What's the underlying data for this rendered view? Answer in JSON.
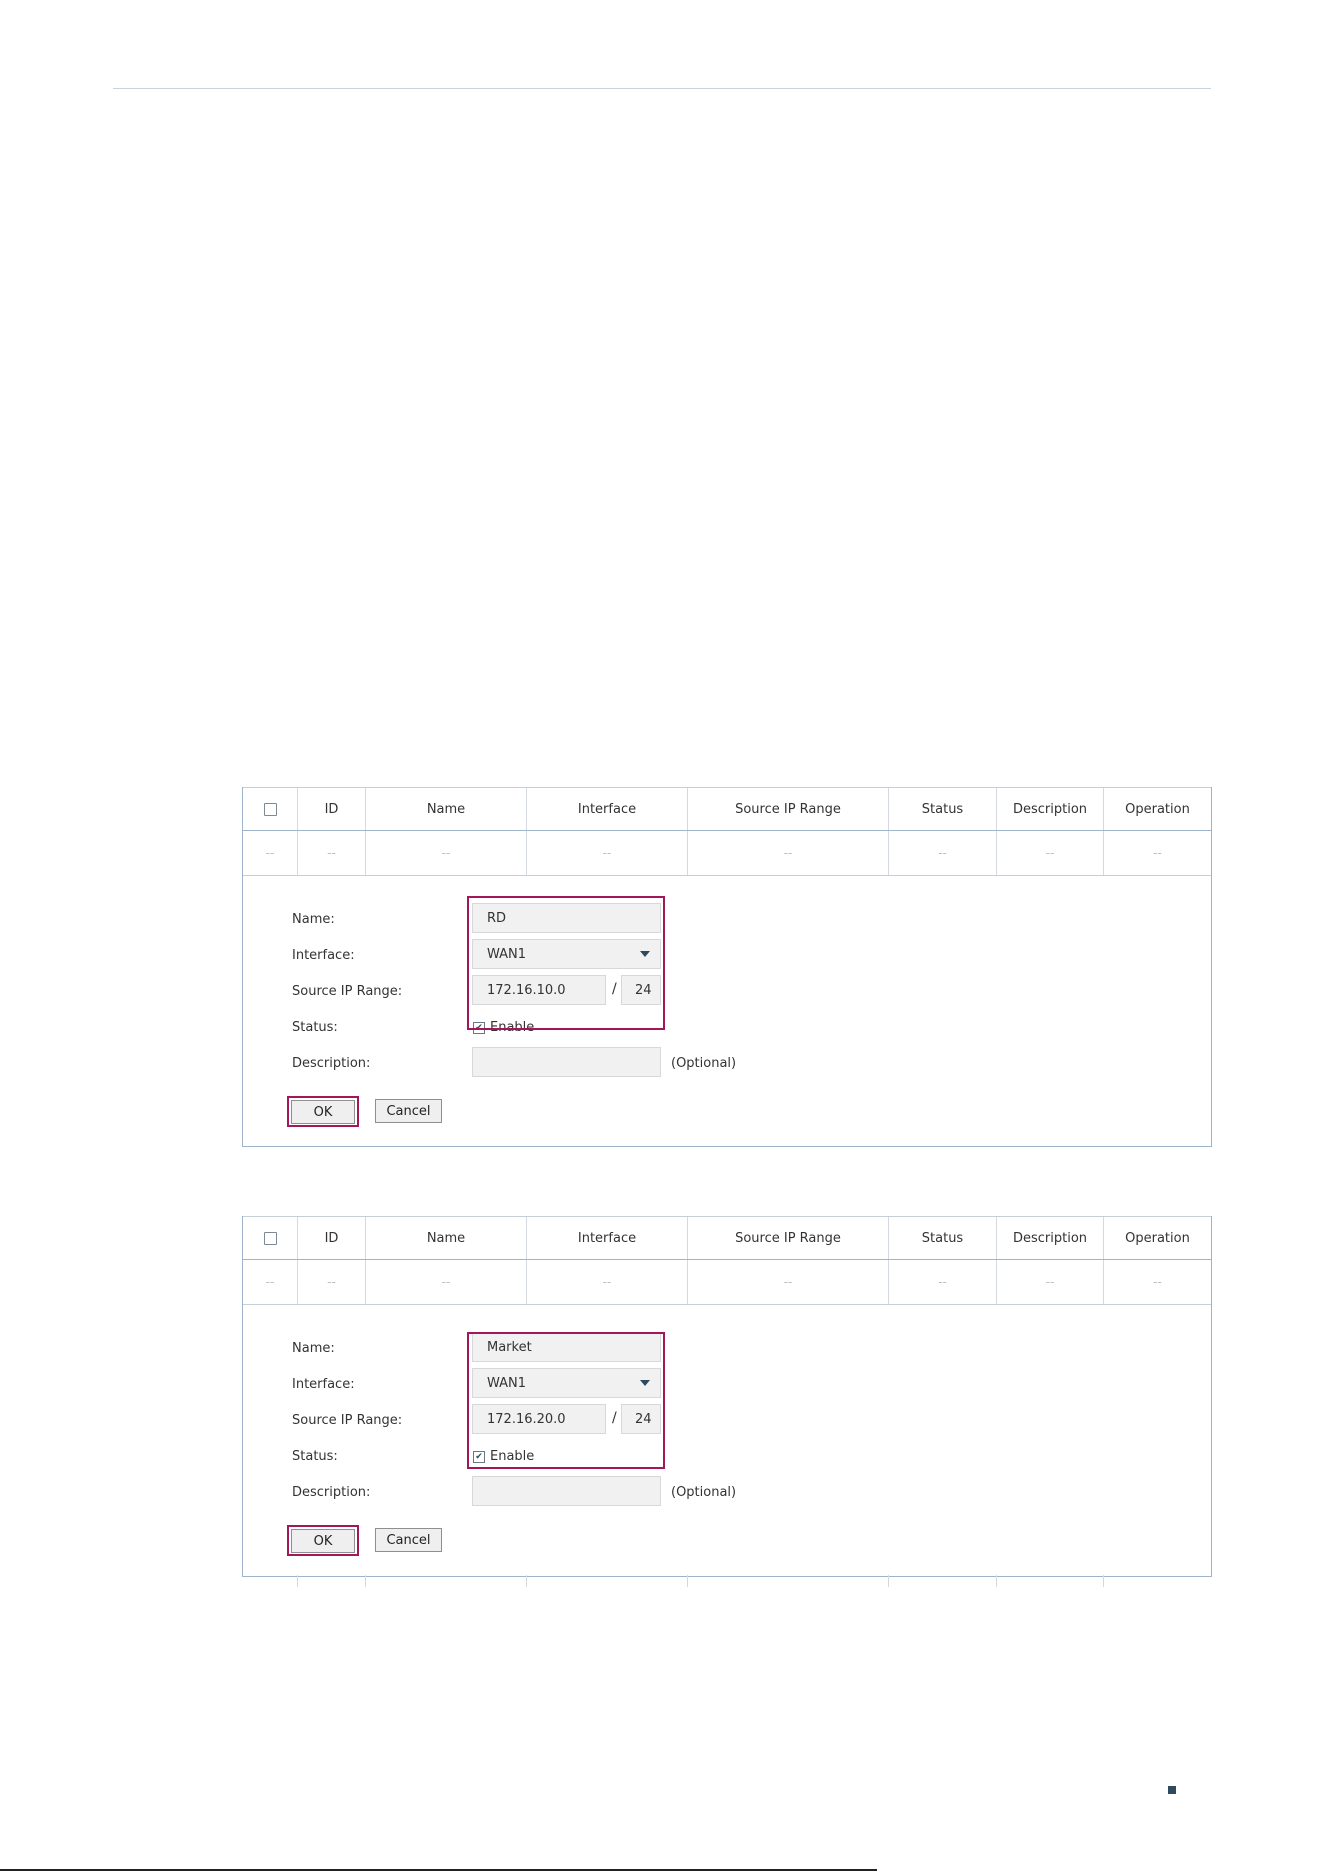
{
  "table": {
    "columns": [
      "ID",
      "Name",
      "Interface",
      "Source IP Range",
      "Status",
      "Description",
      "Operation"
    ],
    "empty_cell": "--"
  },
  "forms": [
    {
      "labels": {
        "name": "Name:",
        "interface": "Interface:",
        "source_ip_range": "Source IP Range:",
        "status": "Status:",
        "description": "Description:"
      },
      "name_value": "RD",
      "interface_value": "WAN1",
      "ip_value": "172.16.10.0",
      "slash": "/",
      "mask_value": "24",
      "status_enabled": true,
      "status_label": "Enable",
      "description_value": "",
      "optional_label": "(Optional)",
      "ok_label": "OK",
      "cancel_label": "Cancel"
    },
    {
      "labels": {
        "name": "Name:",
        "interface": "Interface:",
        "source_ip_range": "Source IP Range:",
        "status": "Status:",
        "description": "Description:"
      },
      "name_value": "Market",
      "interface_value": "WAN1",
      "ip_value": "172.16.20.0",
      "slash": "/",
      "mask_value": "24",
      "status_enabled": true,
      "status_label": "Enable",
      "description_value": "",
      "optional_label": "(Optional)",
      "ok_label": "OK",
      "cancel_label": "Cancel"
    }
  ],
  "colors": {
    "highlight": "#a3175a",
    "panel_border": "#9fb4c8",
    "caret": "#2d4a5e"
  },
  "icons": [
    "checkbox-icon",
    "dropdown-caret-icon",
    "checkmark-icon",
    "page-marker-icon"
  ]
}
